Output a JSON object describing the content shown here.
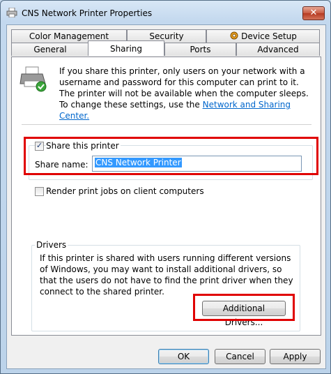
{
  "window": {
    "title": "CNS Network Printer Properties"
  },
  "tabs": {
    "row_top": [
      {
        "label": "Color Management"
      },
      {
        "label": "Security"
      },
      {
        "label": "Device Setup"
      }
    ],
    "row_bottom": [
      {
        "label": "General"
      },
      {
        "label": "Sharing",
        "active": true
      },
      {
        "label": "Ports"
      },
      {
        "label": "Advanced"
      }
    ]
  },
  "sharing": {
    "info_text": "If you share this printer, only users on your network with a username and password for this computer can print to it. The printer will not be available when the computer sleeps. To change these settings, use the ",
    "info_link": "Network and Sharing Center.",
    "share_printer_label": "Share this printer",
    "share_printer_checked": true,
    "share_name_label": "Share name:",
    "share_name_value": "CNS Network Printer",
    "render_client_label": "Render print jobs on client computers",
    "render_client_checked": false
  },
  "drivers": {
    "legend": "Drivers",
    "text": "If this printer is shared with users running different versions of Windows, you may want to install additional drivers, so that the users do not have to find the print driver when they connect to the shared printer.",
    "button_label": "Additional Drivers..."
  },
  "footer": {
    "ok_label": "OK",
    "cancel_label": "Cancel",
    "apply_label": "Apply"
  },
  "colors": {
    "highlight": "#e00000",
    "selection": "#3399ff",
    "link": "#0066cc"
  }
}
